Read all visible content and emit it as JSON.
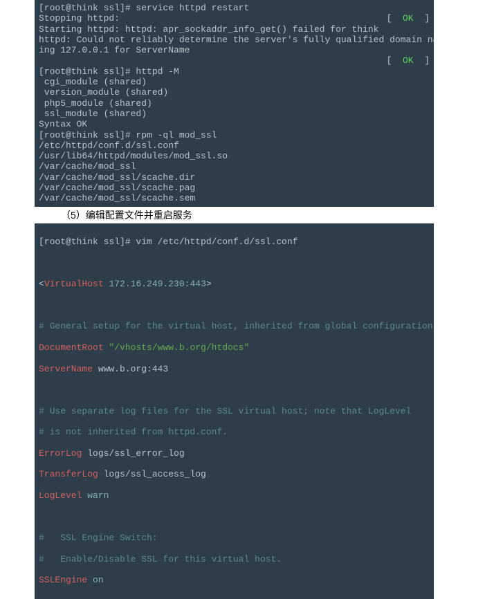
{
  "terminal1": {
    "lines": [
      {
        "text": "[root@think ssl]# service httpd restart"
      },
      {
        "text": "Stopping httpd:",
        "ok": true
      },
      {
        "text": "Starting httpd: httpd: apr_sockaddr_info_get() failed for think"
      },
      {
        "text": "httpd: Could not reliably determine the server's fully qualified domain name, us"
      },
      {
        "text": "ing 127.0.0.1 for ServerName"
      },
      {
        "text": "",
        "ok": true
      },
      {
        "text": "[root@think ssl]# httpd -M"
      },
      {
        "text": " cgi_module (shared)"
      },
      {
        "text": " version_module (shared)"
      },
      {
        "text": " php5_module (shared)"
      },
      {
        "text": " ssl_module (shared)"
      },
      {
        "text": "Syntax OK"
      },
      {
        "text": "[root@think ssl]# rpm -ql mod_ssl"
      },
      {
        "text": "/etc/httpd/conf.d/ssl.conf"
      },
      {
        "text": "/usr/lib64/httpd/modules/mod_ssl.so"
      },
      {
        "text": "/var/cache/mod_ssl"
      },
      {
        "text": "/var/cache/mod_ssl/scache.dir"
      },
      {
        "text": "/var/cache/mod_ssl/scache.pag"
      },
      {
        "text": "/var/cache/mod_ssl/scache.sem"
      }
    ]
  },
  "caption": "（5）编辑配置文件并重启服务",
  "terminal2": {
    "cmd": "[root@think ssl]# vim /etc/httpd/conf.d/ssl.conf",
    "vhost_open": "<",
    "vhost_kw": "VirtualHost",
    "vhost_addr": " 172.16.249.230:443",
    "vhost_close": ">",
    "comment1": "# General setup for the virtual host, inherited from global configuration",
    "docroot_kw": "DocumentRoot",
    "docroot_val": " \"/vhosts/www.b.org/htdocs\"",
    "servername_kw": "ServerName",
    "servername_val": " www.b.org:443",
    "comment2": "# Use separate log files for the SSL virtual host; note that LogLevel",
    "comment3": "# is not inherited from httpd.conf.",
    "errorlog_kw": "ErrorLog",
    "errorlog_val": " logs/ssl_error_log",
    "transferlog_kw": "TransferLog",
    "transferlog_val": " logs/ssl_access_log",
    "loglevel_kw": "LogLevel",
    "loglevel_val": " warn",
    "comment4": "#   SSL Engine Switch:",
    "comment5": "#   Enable/Disable SSL for this virtual host.",
    "sslengine_kw": "SSLEngine",
    "sslengine_val": " on"
  },
  "ok_label": "OK"
}
